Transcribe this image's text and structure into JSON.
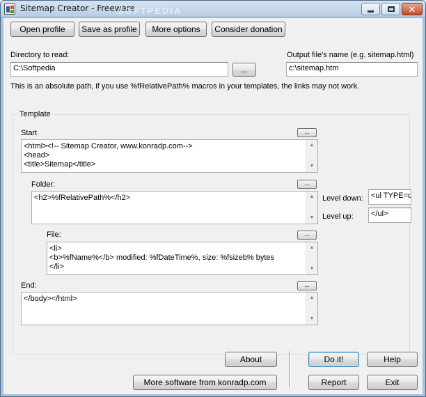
{
  "window": {
    "title": "Sitemap Creator - Freeware",
    "watermark": "SOFTPEDIA",
    "min_icon": "minimize-icon",
    "max_icon": "maximize-icon",
    "close_icon": "close-icon",
    "close_glyph": "✕"
  },
  "toolbar": {
    "open_profile": "Open profile",
    "save_as_profile": "Save as profile",
    "more_options": "More options",
    "consider_donation": "Consider donation"
  },
  "directory": {
    "label": "Directory to read:",
    "value": "C:\\Softpedia",
    "browse": "...",
    "note": "This is an absolute path, if you use %fRelativePath% macros in your templates, the links may not work."
  },
  "output": {
    "label": "Output file's name (e.g. sitemap.html)",
    "value": "c:\\sitemap.htm"
  },
  "template": {
    "group_title": "Template",
    "start": {
      "label": "Start",
      "button": "...",
      "lines": [
        "<html><!-- Sitemap Creator, www.konradp.com-->",
        "<head>",
        "<title>Sitemap</title>"
      ]
    },
    "folder": {
      "label": "Folder:",
      "button": "...",
      "lines": [
        "<h2>%fRelativePath%</h2>"
      ],
      "level_down_label": "Level down:",
      "level_down_value": "<ul TYPE=d",
      "level_up_label": "Level up:",
      "level_up_value": "</ul>"
    },
    "file": {
      "label": "File:",
      "button": "...",
      "lines": [
        "<li>",
        "<b>%fName%</b> modified: %fDateTime%, size: %fsizeb% bytes",
        "</li>"
      ]
    },
    "end": {
      "label": "End:",
      "button": "...",
      "lines": [
        "</body></html>"
      ]
    }
  },
  "scroll_glyphs": {
    "up": "▲",
    "down": "▼"
  },
  "bottom": {
    "about": "About",
    "more_software": "More software from konradp.com",
    "do_it": "Do it!",
    "help": "Help",
    "report": "Report",
    "exit": "Exit"
  }
}
